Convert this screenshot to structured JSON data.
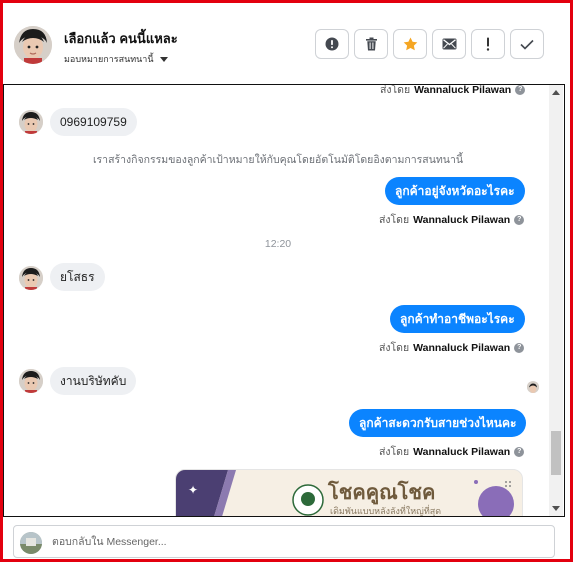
{
  "header": {
    "name": "เลือกแล้ว คนนี้แหละ",
    "assign_label": "มอบหมายการสนทนานี้",
    "tools": [
      {
        "icon": "alert-circle-icon"
      },
      {
        "icon": "trash-icon"
      },
      {
        "icon": "star-icon"
      },
      {
        "icon": "mail-icon"
      },
      {
        "icon": "exclamation-icon"
      },
      {
        "icon": "check-icon"
      }
    ]
  },
  "conversation": {
    "sent_prefix": "ส่งโดย",
    "sender": "Wannaluck Pilawan",
    "messages": [
      {
        "type": "in",
        "text": "0969109759"
      },
      {
        "type": "note",
        "text": "เราสร้างกิจกรรมของลูกค้าเป้าหมายให้กับคุณโดยอัตโนมัติโดยอิงตามการสนทนานี้"
      },
      {
        "type": "out",
        "text": "ลูกค้าอยู่จังหวัดอะไรคะ"
      },
      {
        "type": "time",
        "text": "12:20"
      },
      {
        "type": "in",
        "text": "ยโสธร"
      },
      {
        "type": "out",
        "text": "ลูกค้าทำอาชีพอะไรคะ"
      },
      {
        "type": "in",
        "text": "งานบริษัทคับ"
      },
      {
        "type": "out",
        "text": "ลูกค้าสะดวกรับสายช่วงไหนคะ"
      }
    ],
    "card": {
      "title": "โชคคูณโชค",
      "subtitle": "เดิมพันแบบหลังลังที่ใหญ่ที่สุด"
    }
  },
  "composer": {
    "placeholder": "ตอบกลับใน Messenger..."
  },
  "colors": {
    "frame": "#e3000f",
    "outgoing_bubble": "#0b84ff",
    "incoming_bubble": "#eef0f3",
    "star": "#f5a623"
  }
}
